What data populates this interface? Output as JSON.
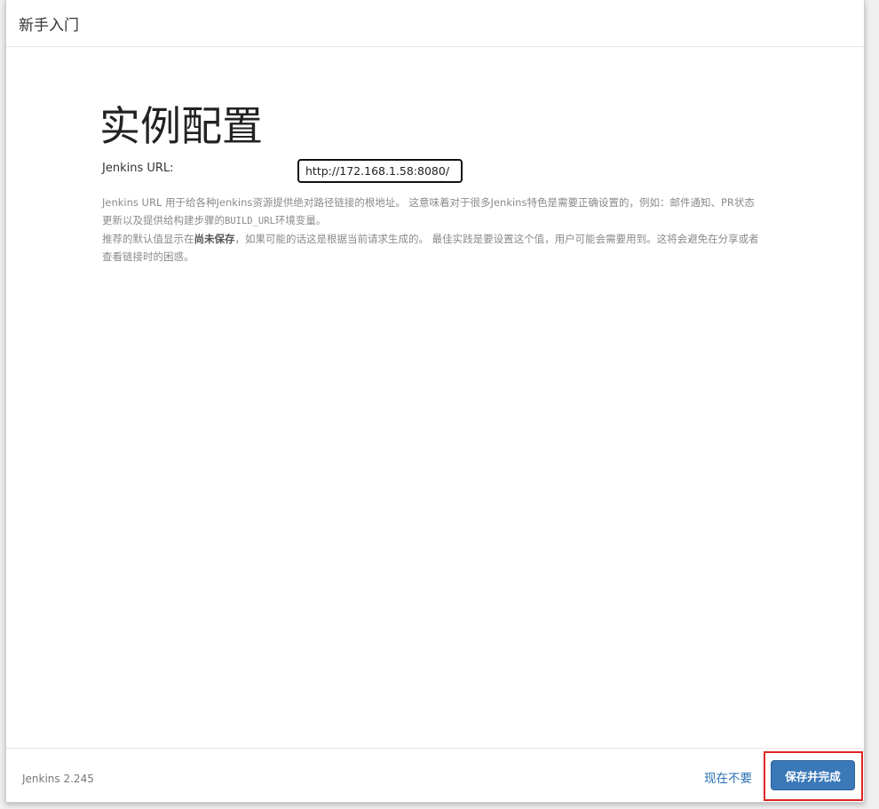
{
  "header": {
    "title": "新手入门"
  },
  "main": {
    "page_title": "实例配置",
    "url_label": "Jenkins URL:",
    "url_value": "http://172.168.1.58:8080/",
    "help_1a": "Jenkins URL 用于给各种Jenkins资源提供绝对路径链接的根地址。 这意味着对于很多Jenkins特色是需要正确设置的，例如：邮件通知、PR状态更新以及提供给构建步骤的",
    "help_1_code": "BUILD_URL",
    "help_1b": "环境变量。",
    "help_2a": "推荐的默认值显示在",
    "help_2_strong": "尚未保存",
    "help_2b": "，如果可能的话这是根据当前请求生成的。 最佳实践是要设置这个值，用户可能会需要用到。这将会避免在分享或者查看链接时的困惑。"
  },
  "footer": {
    "version": "Jenkins 2.245",
    "skip_label": "现在不要",
    "save_label": "保存并完成"
  },
  "colors": {
    "primary_button": "#3a78b8",
    "link": "#2a6fb0",
    "highlight": "#e02424"
  }
}
